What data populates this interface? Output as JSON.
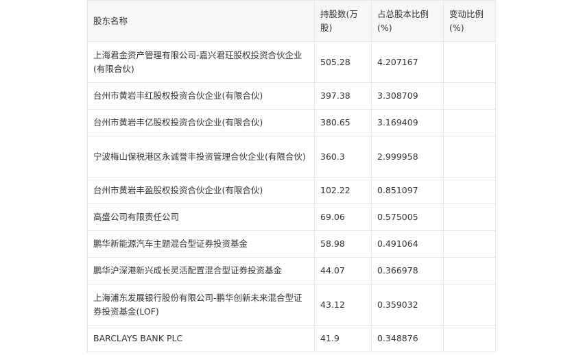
{
  "table": {
    "headers": [
      "股东名称",
      "持股数(万股)",
      "占总股本比例(%)",
      "变动比例(%)"
    ],
    "rows": [
      {
        "name": "上海君金资产管理有限公司-嘉兴君玨股权投资合伙企业(有限合伙)",
        "shares": "505.28",
        "ratio": "4.207167",
        "change": ""
      },
      {
        "name": "台州市黄岩丰红股权投资合伙企业(有限合伙)",
        "shares": "397.38",
        "ratio": "3.308709",
        "change": ""
      },
      {
        "name": "台州市黄岩丰亿股权投资合伙企业(有限合伙)",
        "shares": "380.65",
        "ratio": "3.169409",
        "change": ""
      },
      {
        "name": "宁波梅山保税港区永诚誉丰投资管理合伙企业(有限合伙)",
        "shares": "360.3",
        "ratio": "2.999958",
        "change": ""
      },
      {
        "name": "台州市黄岩丰盈股权投资合伙企业(有限合伙)",
        "shares": "102.22",
        "ratio": "0.851097",
        "change": ""
      },
      {
        "name": "高盛公司有限责任公司",
        "shares": "69.06",
        "ratio": "0.575005",
        "change": ""
      },
      {
        "name": "鹏华新能源汽车主题混合型证券投资基金",
        "shares": "58.98",
        "ratio": "0.491064",
        "change": ""
      },
      {
        "name": "鹏华沪深港新兴成长灵活配置混合型证券投资基金",
        "shares": "44.07",
        "ratio": "0.366978",
        "change": ""
      },
      {
        "name": "上海浦东发展银行股份有限公司-鹏华创新未来混合型证券投资基金(LOF)",
        "shares": "43.12",
        "ratio": "0.359032",
        "change": ""
      },
      {
        "name": "BARCLAYS BANK PLC",
        "shares": "41.9",
        "ratio": "0.348876",
        "change": ""
      }
    ]
  }
}
